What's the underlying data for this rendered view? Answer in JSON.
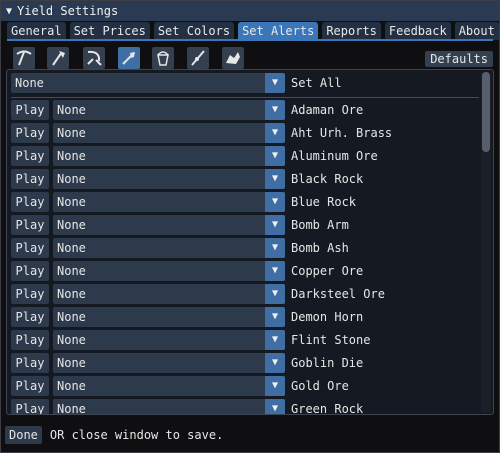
{
  "window": {
    "title": "Yield Settings"
  },
  "tabs": [
    {
      "label": "General",
      "active": false
    },
    {
      "label": "Set Prices",
      "active": false
    },
    {
      "label": "Set Colors",
      "active": false
    },
    {
      "label": "Set Alerts",
      "active": true
    },
    {
      "label": "Reports",
      "active": false
    },
    {
      "label": "Feedback",
      "active": false
    },
    {
      "label": "About",
      "active": false
    }
  ],
  "tools": [
    {
      "icon": "pickaxe-icon",
      "active": false
    },
    {
      "icon": "hatchet-icon",
      "active": false
    },
    {
      "icon": "sickle-icon",
      "active": false
    },
    {
      "icon": "shovel-icon",
      "active": true
    },
    {
      "icon": "bucket-icon",
      "active": false
    },
    {
      "icon": "fishing-rod-icon",
      "active": false
    },
    {
      "icon": "beast-icon",
      "active": false
    }
  ],
  "defaults_label": "Defaults",
  "set_all": {
    "value": "None",
    "label": "Set All"
  },
  "play_label": "Play",
  "rows": [
    {
      "value": "None",
      "label": "Adaman Ore"
    },
    {
      "value": "None",
      "label": "Aht Urh. Brass"
    },
    {
      "value": "None",
      "label": "Aluminum Ore"
    },
    {
      "value": "None",
      "label": "Black Rock"
    },
    {
      "value": "None",
      "label": "Blue Rock"
    },
    {
      "value": "None",
      "label": "Bomb Arm"
    },
    {
      "value": "None",
      "label": "Bomb Ash"
    },
    {
      "value": "None",
      "label": "Copper Ore"
    },
    {
      "value": "None",
      "label": "Darksteel Ore"
    },
    {
      "value": "None",
      "label": "Demon Horn"
    },
    {
      "value": "None",
      "label": "Flint Stone"
    },
    {
      "value": "None",
      "label": "Goblin Die"
    },
    {
      "value": "None",
      "label": "Gold Ore"
    },
    {
      "value": "None",
      "label": "Green Rock"
    }
  ],
  "footer": {
    "done_label": "Done",
    "hint": "OR close window to save."
  }
}
